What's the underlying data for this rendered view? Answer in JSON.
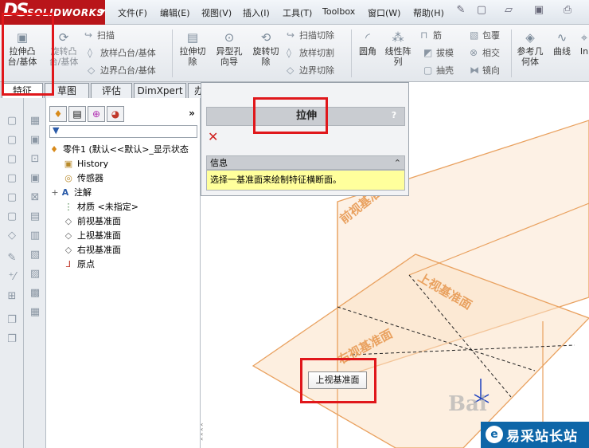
{
  "app": {
    "logo_text": "SOLIDWORKS",
    "logo_mark": "DS"
  },
  "menu": [
    "文件(F)",
    "编辑(E)",
    "视图(V)",
    "插入(I)",
    "工具(T)",
    "Toolbox",
    "窗口(W)",
    "帮助(H)"
  ],
  "ribbon": {
    "extrude_boss": "拉伸凸\n台/基体",
    "revolve_boss": "旋转凸\n台/基体",
    "sweep": "扫描",
    "loft": "放样凸台/基体",
    "boundary": "边界凸台/基体",
    "extrude_cut": "拉伸切\n除",
    "hole_wizard": "异型孔\n向导",
    "revolve_cut": "旋转切\n除",
    "swept_cut": "扫描切除",
    "lofted_cut": "放样切割",
    "boundary_cut": "边界切除",
    "fillet": "圆角",
    "linear_pattern": "线性阵\n列",
    "rib": "筋",
    "draft": "拔模",
    "shell": "抽壳",
    "wrap": "包覆",
    "intersect": "相交",
    "mirror": "镜向",
    "ref_geometry": "参考几\n何体",
    "curves": "曲线",
    "instant3d": "In"
  },
  "tabs": [
    "特征",
    "草图",
    "评估",
    "DimXpert",
    "办公室产品"
  ],
  "tree": {
    "root": "零件1  (默认<<默认>_显示状态",
    "items": [
      "History",
      "传感器",
      "注解",
      "材质 <未指定>",
      "前视基准面",
      "上视基准面",
      "右视基准面",
      "原点"
    ]
  },
  "property_manager": {
    "title": "拉伸",
    "help": "?",
    "info_label": "信息",
    "info_message": "选择一基准面来绘制特征横断面。"
  },
  "viewport": {
    "plane_front": "前视基准面",
    "plane_top": "上视基准面",
    "plane_top_lower": "右视基准面",
    "tooltip": "上视基准面"
  },
  "watermark": {
    "baidu": "Bai",
    "site": "易采站长站"
  },
  "colors": {
    "accent_red": "#e0171b",
    "plane_orange": "#e9a15f",
    "info_yellow": "#ffff9c",
    "logo_red": "#b9151a"
  }
}
